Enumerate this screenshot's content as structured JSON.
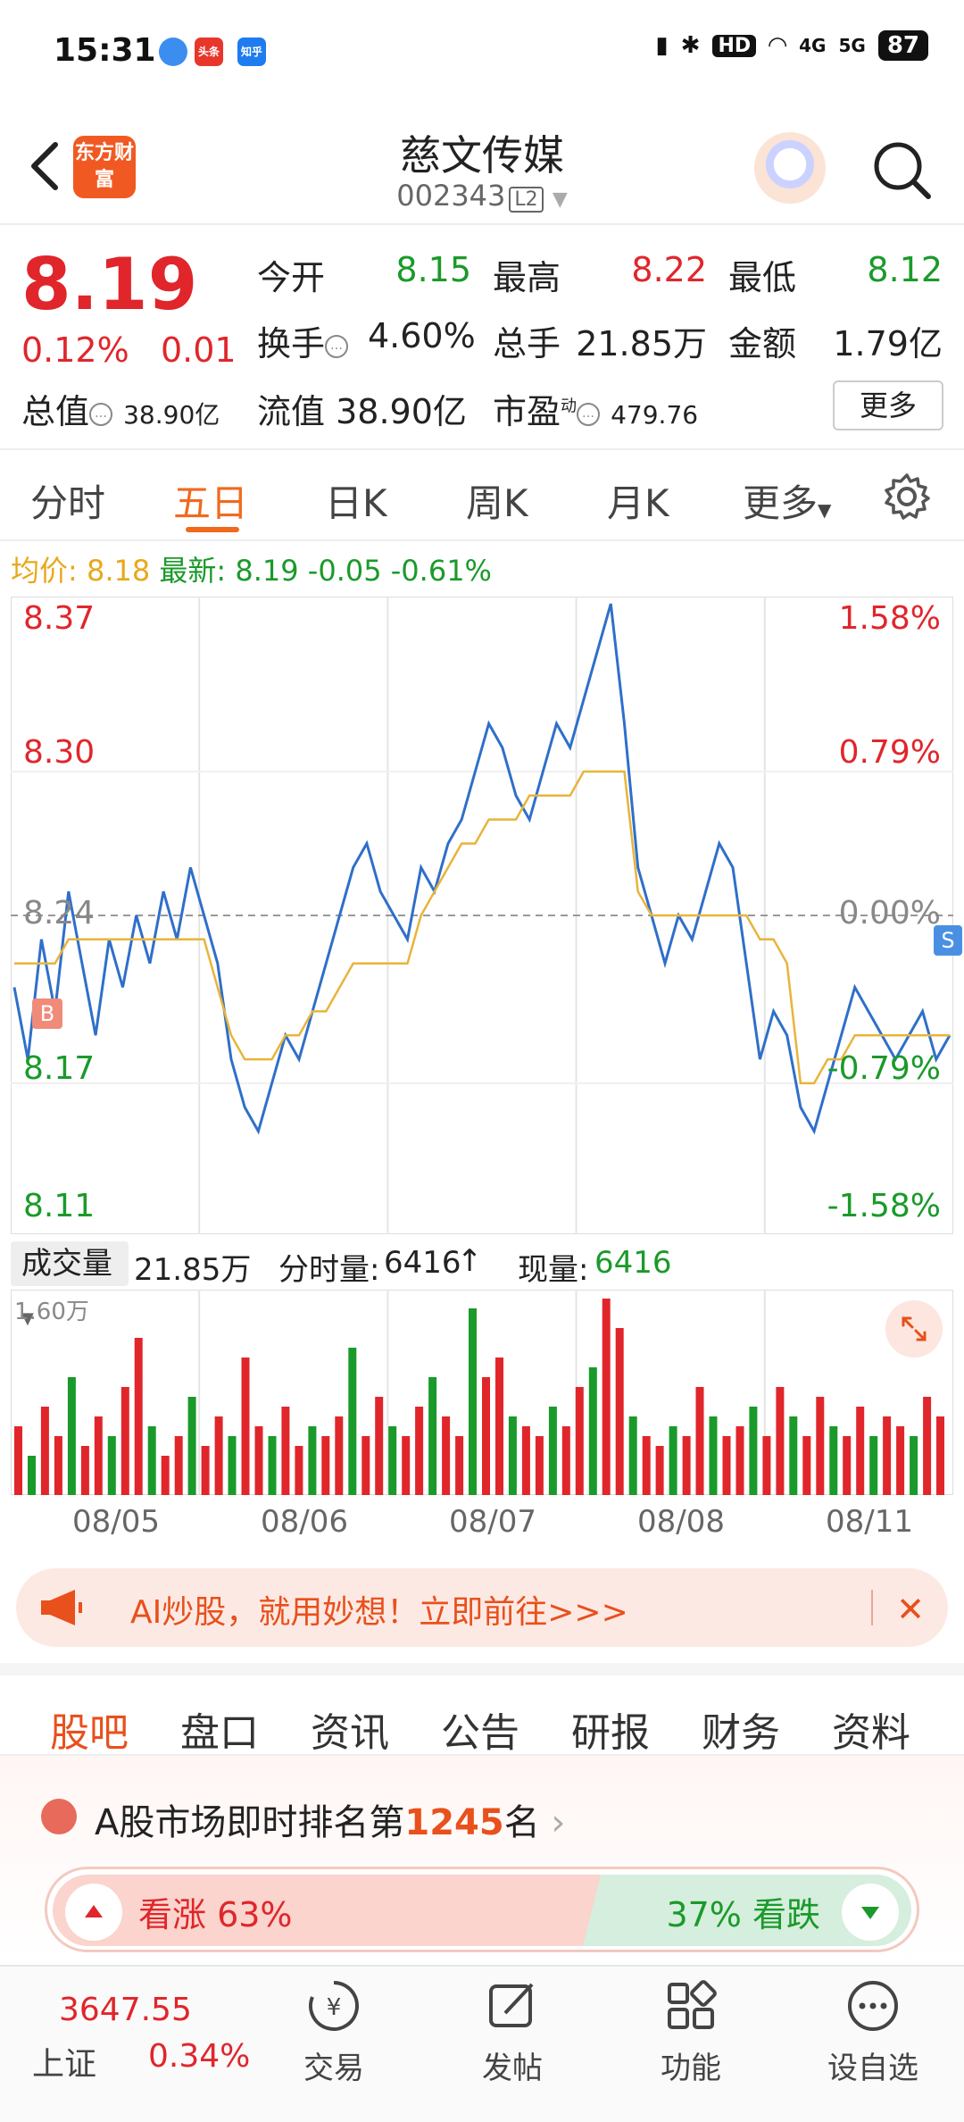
{
  "status_bar": {
    "time": "15:31",
    "apps": [
      "头条",
      "知乎"
    ],
    "network": "HD",
    "signal_4g": "4G",
    "signal_5g": "5G",
    "battery": "87"
  },
  "header": {
    "logo_text": "东方财富",
    "stock_name": "慈文传媒",
    "stock_code": "002343",
    "level_badge": "L2"
  },
  "quote": {
    "price": "8.19",
    "change_pct": "0.12%",
    "change": "0.01",
    "open_label": "今开",
    "open": "8.15",
    "high_label": "最高",
    "high": "8.22",
    "low_label": "最低",
    "low": "8.12",
    "turnover_label": "换手",
    "turnover": "4.60%",
    "volume_label": "总手",
    "volume": "21.85万",
    "amount_label": "金额",
    "amount": "1.79亿",
    "mktcap_label": "总值",
    "mktcap": "38.90亿",
    "float_label": "流值",
    "float": "38.90亿",
    "pe_label": "市盈",
    "pe_sup": "动",
    "pe": "479.76",
    "more_label": "更多"
  },
  "chart_tabs": {
    "items": [
      "分时",
      "五日",
      "日K",
      "周K",
      "月K",
      "更多"
    ],
    "active": "五日"
  },
  "info_line": {
    "avg_label": "均价:",
    "avg": "8.18",
    "latest_label": "最新:",
    "latest": "8.19",
    "change": "-0.05",
    "change_pct": "-0.61%"
  },
  "chart_data": {
    "type": "line",
    "title": "",
    "y_left_ticks": [
      "8.37",
      "8.30",
      "8.24",
      "8.17",
      "8.11"
    ],
    "y_right_ticks": [
      "1.58%",
      "0.79%",
      "0.00%",
      "-0.79%",
      "-1.58%"
    ],
    "ylim": [
      8.11,
      8.37
    ],
    "x_dates": [
      "08/05",
      "08/06",
      "08/07",
      "08/08",
      "08/11"
    ],
    "ref_price": 8.24,
    "markers": {
      "buy": "B",
      "sell": "S"
    },
    "series": [
      {
        "name": "",
        "color": "#2f6fc9",
        "values": [
          8.21,
          8.18,
          8.23,
          8.2,
          8.25,
          8.22,
          8.19,
          8.23,
          8.21,
          8.24,
          8.22,
          8.25,
          8.23,
          8.26,
          8.24,
          8.22,
          8.18,
          8.16,
          8.15,
          8.17,
          8.19,
          8.18,
          8.2,
          8.22,
          8.24,
          8.26,
          8.27,
          8.25,
          8.24,
          8.23,
          8.26,
          8.25,
          8.27,
          8.28,
          8.3,
          8.32,
          8.31,
          8.29,
          8.28,
          8.3,
          8.32,
          8.31,
          8.33,
          8.35,
          8.37,
          8.32,
          8.26,
          8.24,
          8.22,
          8.24,
          8.23,
          8.25,
          8.27,
          8.26,
          8.22,
          8.18,
          8.2,
          8.19,
          8.16,
          8.15,
          8.17,
          8.19,
          8.21,
          8.2,
          8.19,
          8.18,
          8.19,
          8.2,
          8.18,
          8.19
        ]
      },
      {
        "name": "",
        "color": "#e8b43c",
        "values": [
          8.22,
          8.22,
          8.22,
          8.22,
          8.23,
          8.23,
          8.23,
          8.23,
          8.23,
          8.23,
          8.23,
          8.23,
          8.23,
          8.23,
          8.23,
          8.21,
          8.19,
          8.18,
          8.18,
          8.18,
          8.19,
          8.19,
          8.2,
          8.2,
          8.21,
          8.22,
          8.22,
          8.22,
          8.22,
          8.22,
          8.24,
          8.25,
          8.26,
          8.27,
          8.27,
          8.28,
          8.28,
          8.28,
          8.29,
          8.29,
          8.29,
          8.29,
          8.3,
          8.3,
          8.3,
          8.3,
          8.25,
          8.24,
          8.24,
          8.24,
          8.24,
          8.24,
          8.24,
          8.24,
          8.24,
          8.23,
          8.23,
          8.22,
          8.17,
          8.17,
          8.18,
          8.18,
          8.19,
          8.19,
          8.19,
          8.19,
          8.19,
          8.19,
          8.19,
          8.19
        ]
      }
    ]
  },
  "volume": {
    "selector": "成交量",
    "total": "21.85万",
    "minute_label": "分时量:",
    "minute": "6416",
    "current_label": "现量:",
    "current": "6416",
    "max_tick": "1.60万"
  },
  "volume_data": {
    "values": [
      0.35,
      0.2,
      0.45,
      0.3,
      0.6,
      0.25,
      0.4,
      0.3,
      0.55,
      0.8,
      0.35,
      0.2,
      0.3,
      0.5,
      0.25,
      0.4,
      0.3,
      0.7,
      0.35,
      0.3,
      0.45,
      0.25,
      0.35,
      0.3,
      0.4,
      0.75,
      0.3,
      0.5,
      0.35,
      0.3,
      0.45,
      0.6,
      0.4,
      0.3,
      0.95,
      0.6,
      0.7,
      0.4,
      0.35,
      0.3,
      0.45,
      0.35,
      0.55,
      0.65,
      1.0,
      0.85,
      0.4,
      0.3,
      0.25,
      0.35,
      0.3,
      0.55,
      0.4,
      0.3,
      0.35,
      0.45,
      0.3,
      0.55,
      0.4,
      0.3,
      0.5,
      0.35,
      0.3,
      0.45,
      0.3,
      0.4,
      0.35,
      0.3,
      0.5,
      0.4
    ],
    "colors_up": "#e0262b",
    "colors_down": "#1a9a2a"
  },
  "ai_banner": {
    "text": "AI炒股，就用妙想！立即前往>>>"
  },
  "news_tabs": {
    "items": [
      "股吧",
      "盘口",
      "资讯",
      "公告",
      "研报",
      "财务",
      "资料"
    ],
    "active": "股吧"
  },
  "rank": {
    "prefix": "A股市场即时排名第",
    "number": "1245",
    "suffix": "名",
    "bull_label": "看涨 63%",
    "bear_label": "37% 看跌",
    "bull_pct": 63
  },
  "bottom_nav": {
    "index_value": "3647.55",
    "index_name": "上证",
    "index_pct": "0.34%",
    "items": [
      "交易",
      "发帖",
      "功能",
      "设自选"
    ]
  }
}
